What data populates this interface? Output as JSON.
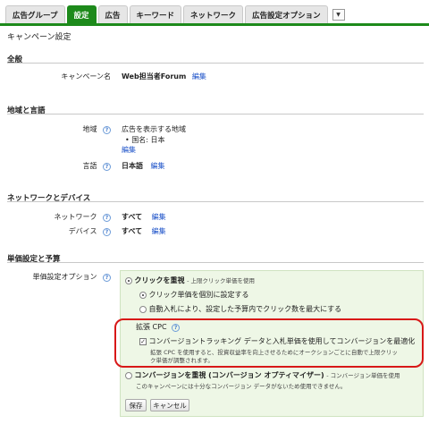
{
  "tabs": [
    {
      "label": "広告グループ",
      "active": false
    },
    {
      "label": "設定",
      "active": true
    },
    {
      "label": "広告",
      "active": false
    },
    {
      "label": "キーワード",
      "active": false
    },
    {
      "label": "ネットワーク",
      "active": false
    },
    {
      "label": "広告設定オプション",
      "active": false
    }
  ],
  "tab_more_icon": "▼",
  "page_title": "キャンペーン設定",
  "sections": {
    "general": {
      "title": "全般",
      "campaign_label": "キャンペーン名",
      "campaign_value": "Web担当者Forum",
      "edit": "編集"
    },
    "location_language": {
      "title": "地域と言語",
      "location_label": "地域",
      "location_desc": "広告を表示する地域",
      "country_item": "国名: 日本",
      "location_edit": "編集",
      "language_label": "言語",
      "language_value": "日本語",
      "language_edit": "編集"
    },
    "network": {
      "title": "ネットワークとデバイス",
      "network_label": "ネットワーク",
      "network_value": "すべて",
      "network_edit": "編集",
      "device_label": "デバイス",
      "device_value": "すべて",
      "device_edit": "編集"
    },
    "bidding": {
      "title": "単価設定と予算",
      "option_label": "単価設定オプション",
      "click_focus": "クリックを重視",
      "click_focus_note": "- 上限クリック単価を使用",
      "manual_bid": "クリック単価を個別に設定する",
      "auto_bid": "自動入札により、設定した予算内でクリック数を最大にする",
      "ecpc_title": "拡張 CPC",
      "ecpc_checkbox": "コンバージョントラッキング データと入札単価を使用してコンバージョンを最適化",
      "ecpc_desc_1": "拡張 CPC を使用すると、投資収益率を向上させるためにオークションごとに自動で上限クリッ",
      "ecpc_desc_2": "ク単価が調整されます。",
      "conversion_focus": "コンバージョンを重視 (コンバージョン オプティマイザー)",
      "conversion_focus_note": "- コンバージョン単価を使用",
      "conversion_desc": "このキャンペーンには十分なコンバージョン データがないため使用できません。",
      "save": "保存",
      "cancel": "キャンセル"
    }
  },
  "help_icon": "?",
  "colors": {
    "tab_active": "#1d8a1b",
    "link": "#1a50c8",
    "highlight": "#d81818",
    "panel": "#eef7e6"
  }
}
